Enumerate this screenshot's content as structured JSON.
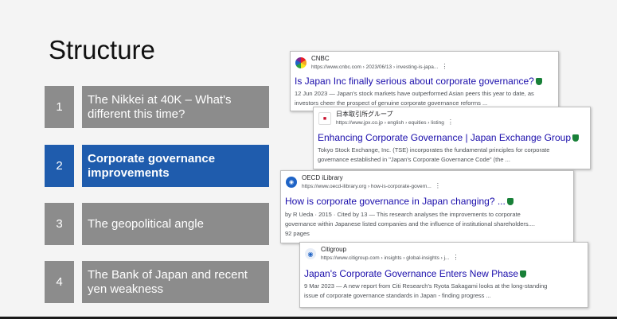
{
  "slide": {
    "title": "Structure",
    "items": [
      {
        "number": "1",
        "label": "The Nikkei at 40K – What's different this time?"
      },
      {
        "number": "2",
        "label": "Corporate governance improvements"
      },
      {
        "number": "3",
        "label": "The geopolitical angle"
      },
      {
        "number": "4",
        "label": "The Bank of Japan and recent yen weakness"
      }
    ]
  },
  "results": [
    {
      "source": "CNBC",
      "url": "https://www.cnbc.com › 2023/06/13 › investing-is-japa...",
      "title": "Is Japan Inc finally serious about corporate governance?",
      "snippet1": "12 Jun 2023 — Japan's stock markets have outperformed Asian peers this year to date, as",
      "snippet2": "investors cheer the prospect of genuine corporate governance reforms ..."
    },
    {
      "source": "日本取引所グループ",
      "url": "https://www.jpx.co.jp › english › equities › listing",
      "title": "Enhancing Corporate Governance | Japan Exchange Group",
      "snippet1": "Tokyo Stock Exchange, Inc. (TSE) incorporates the fundamental principles for corporate",
      "snippet2": "governance established in \"Japan's Corporate Governance Code\" (the ..."
    },
    {
      "source": "OECD iLibrary",
      "url": "https://www.oecd-ilibrary.org › how-is-corporate-govern...",
      "title": "How is corporate governance in Japan changing? ...",
      "snippet1": "by R Ueda · 2015 · Cited by 13 — This research analyses the improvements to corporate",
      "snippet2": "governance within Japanese listed companies and the influence of institutional shareholders....",
      "snippet3": "92 pages"
    },
    {
      "source": "Citigroup",
      "url": "https://www.citigroup.com › insights › global-insights › j...",
      "title": "Japan's Corporate Governance Enters New Phase",
      "snippet1": "9 Mar 2023 — A new report from Citi Research's Ryota Sakagami looks at the long-standing",
      "snippet2": "issue of corporate governance standards in Japan - finding progress ..."
    }
  ],
  "colors": {
    "item_grey": "#8c8c8c",
    "item_active": "#1f5cad",
    "link_blue": "#1a0dab",
    "verified_green": "#188038"
  },
  "icons": {
    "dots": "⋮"
  }
}
